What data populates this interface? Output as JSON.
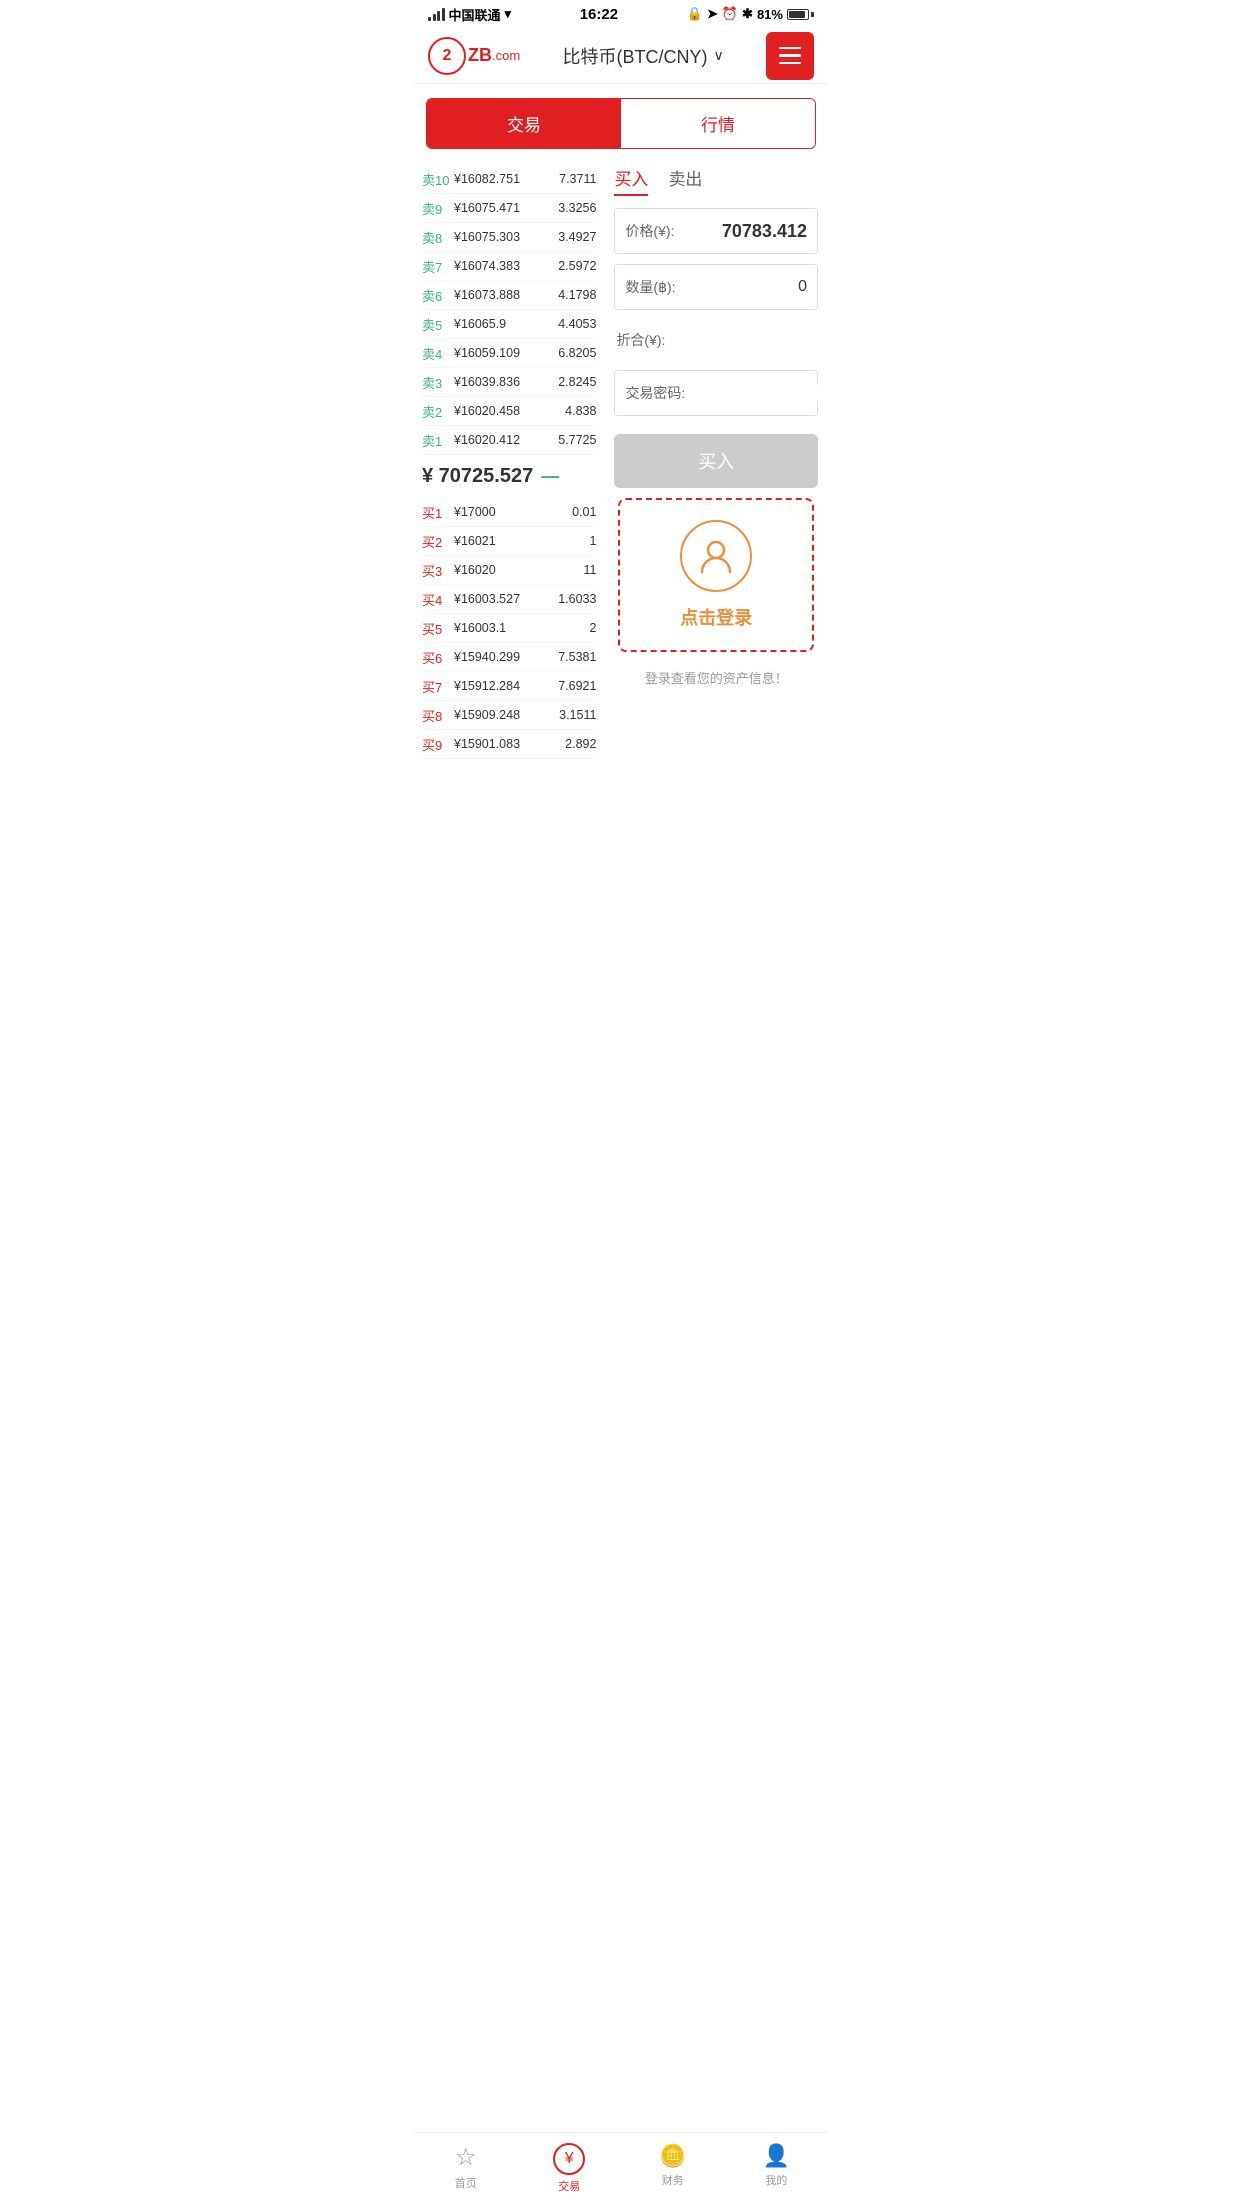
{
  "status_bar": {
    "carrier": "中国联通",
    "time": "16:22",
    "battery": "81%"
  },
  "header": {
    "title": "比特币(BTC/CNY)",
    "menu_icon": "≡"
  },
  "tabs": [
    {
      "label": "交易",
      "active": true
    },
    {
      "label": "行情",
      "active": false
    }
  ],
  "buy_sell_tabs": [
    {
      "label": "买入",
      "active": true
    },
    {
      "label": "卖出",
      "active": false
    }
  ],
  "sell_orders": [
    {
      "label": "卖10",
      "price": "¥16082.751",
      "qty": "7.3711"
    },
    {
      "label": "卖9",
      "price": "¥16075.471",
      "qty": "3.3256"
    },
    {
      "label": "卖8",
      "price": "¥16075.303",
      "qty": "3.4927"
    },
    {
      "label": "卖7",
      "price": "¥16074.383",
      "qty": "2.5972"
    },
    {
      "label": "卖6",
      "price": "¥16073.888",
      "qty": "4.1798"
    },
    {
      "label": "卖5",
      "price": "¥16065.9",
      "qty": "4.4053"
    },
    {
      "label": "卖4",
      "price": "¥16059.109",
      "qty": "6.8205"
    },
    {
      "label": "卖3",
      "price": "¥16039.836",
      "qty": "2.8245"
    },
    {
      "label": "卖2",
      "price": "¥16020.458",
      "qty": "4.838"
    },
    {
      "label": "卖1",
      "price": "¥16020.412",
      "qty": "5.7725"
    }
  ],
  "mid_price": "¥ 70725.527",
  "mid_trend": "—",
  "buy_orders": [
    {
      "label": "买1",
      "price": "¥17000",
      "qty": "0.01"
    },
    {
      "label": "买2",
      "price": "¥16021",
      "qty": "1"
    },
    {
      "label": "买3",
      "price": "¥16020",
      "qty": "11"
    },
    {
      "label": "买4",
      "price": "¥16003.527",
      "qty": "1.6033"
    },
    {
      "label": "买5",
      "price": "¥16003.1",
      "qty": "2"
    },
    {
      "label": "买6",
      "price": "¥15940.299",
      "qty": "7.5381"
    },
    {
      "label": "买7",
      "price": "¥15912.284",
      "qty": "7.6921"
    },
    {
      "label": "买8",
      "price": "¥15909.248",
      "qty": "3.1511"
    },
    {
      "label": "买9",
      "price": "¥15901.083",
      "qty": "2.892"
    }
  ],
  "trade_form": {
    "price_label": "价格(¥):",
    "price_value": "70783.412",
    "qty_label": "数量(฿):",
    "qty_value": "0",
    "total_label": "折合(¥):",
    "total_value": "",
    "password_label": "交易密码:",
    "password_value": ""
  },
  "buy_button_label": "买入",
  "login_box": {
    "login_text": "点击登录",
    "hint_text": "登录查看您的资产信息！"
  },
  "bottom_nav": [
    {
      "label": "首页",
      "icon": "☆",
      "active": false
    },
    {
      "label": "交易",
      "icon": "¥",
      "active": true
    },
    {
      "label": "财务",
      "icon": "💰",
      "active": false
    },
    {
      "label": "我的",
      "icon": "👤",
      "active": false
    }
  ]
}
